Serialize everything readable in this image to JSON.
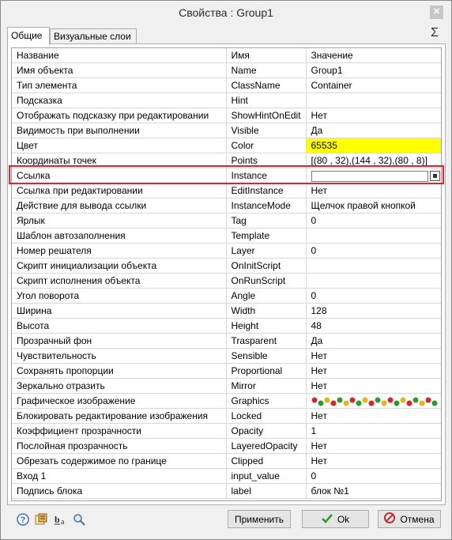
{
  "window": {
    "title": "Свойства :  Group1",
    "close_label": "✕"
  },
  "tabs": [
    {
      "label": "Общие"
    },
    {
      "label": "Визуальные слои"
    }
  ],
  "sum_icon": "Σ",
  "table": {
    "headers": [
      "Название",
      "Имя",
      "Значение"
    ],
    "rows": [
      {
        "name": "Имя объекта",
        "key": "Name",
        "value": "Group1"
      },
      {
        "name": "Тип элемента",
        "key": "ClassName",
        "value": "Container"
      },
      {
        "name": "Подсказка",
        "key": "Hint",
        "value": ""
      },
      {
        "name": "Отображать подсказку при редактировании",
        "key": "ShowHintOnEdit",
        "value": "Нет"
      },
      {
        "name": "Видимость при выполнении",
        "key": "Visible",
        "value": "Да"
      },
      {
        "name": "Цвет",
        "key": "Color",
        "value": "65535"
      },
      {
        "name": "Координаты точек",
        "key": "Points",
        "value": "[(80 , 32),(144 , 32),(80 , 8)]"
      },
      {
        "name": "Ссылка",
        "key": "Instance",
        "value": ""
      },
      {
        "name": "Ссылка при редактировании",
        "key": "EditInstance",
        "value": "Нет"
      },
      {
        "name": "Действие для вывода ссылки",
        "key": "InstanceMode",
        "value": "Щелчок правой кнопкой"
      },
      {
        "name": "Ярлык",
        "key": "Tag",
        "value": "0"
      },
      {
        "name": "Шаблон автозаполнения",
        "key": "Template",
        "value": ""
      },
      {
        "name": "Номер решателя",
        "key": "Layer",
        "value": "0"
      },
      {
        "name": "Скрипт инициализации объекта",
        "key": "OnInitScript",
        "value": ""
      },
      {
        "name": "Скрипт исполнения объекта",
        "key": "OnRunScript",
        "value": ""
      },
      {
        "name": "Угол поворота",
        "key": "Angle",
        "value": "0"
      },
      {
        "name": "Ширина",
        "key": "Width",
        "value": "128"
      },
      {
        "name": "Высота",
        "key": "Height",
        "value": "48"
      },
      {
        "name": "Прозрачный фон",
        "key": "Trasparent",
        "value": "Да"
      },
      {
        "name": "Чувствительность",
        "key": "Sensible",
        "value": "Нет"
      },
      {
        "name": "Сохранять пропорции",
        "key": "Proportional",
        "value": "Нет"
      },
      {
        "name": "Зеркально отразить",
        "key": "Mirror",
        "value": "Нет"
      },
      {
        "name": "Графическое изображение",
        "key": "Graphics",
        "value": ""
      },
      {
        "name": "Блокировать редактирование изображения",
        "key": "Locked",
        "value": "Нет"
      },
      {
        "name": "Коэффициент прозрачности",
        "key": "Opacity",
        "value": "1"
      },
      {
        "name": "Послойная прозрачность",
        "key": "LayeredOpacity",
        "value": "Нет"
      },
      {
        "name": "Обрезать содержимое по границе",
        "key": "Clipped",
        "value": "Нет"
      },
      {
        "name": "Вход 1",
        "key": "input_value",
        "value": "0"
      },
      {
        "name": "Подпись блока",
        "key": "label",
        "value": "блок №1"
      }
    ]
  },
  "colors": {
    "highlight": "#ffff00",
    "selection_outline": "#e0242b"
  },
  "bottom": {
    "icons": [
      "help-icon",
      "properties-icon",
      "text-format-icon",
      "search-icon"
    ],
    "apply_label": "Применить",
    "ok_label": "Ok",
    "cancel_label": "Отмена"
  }
}
